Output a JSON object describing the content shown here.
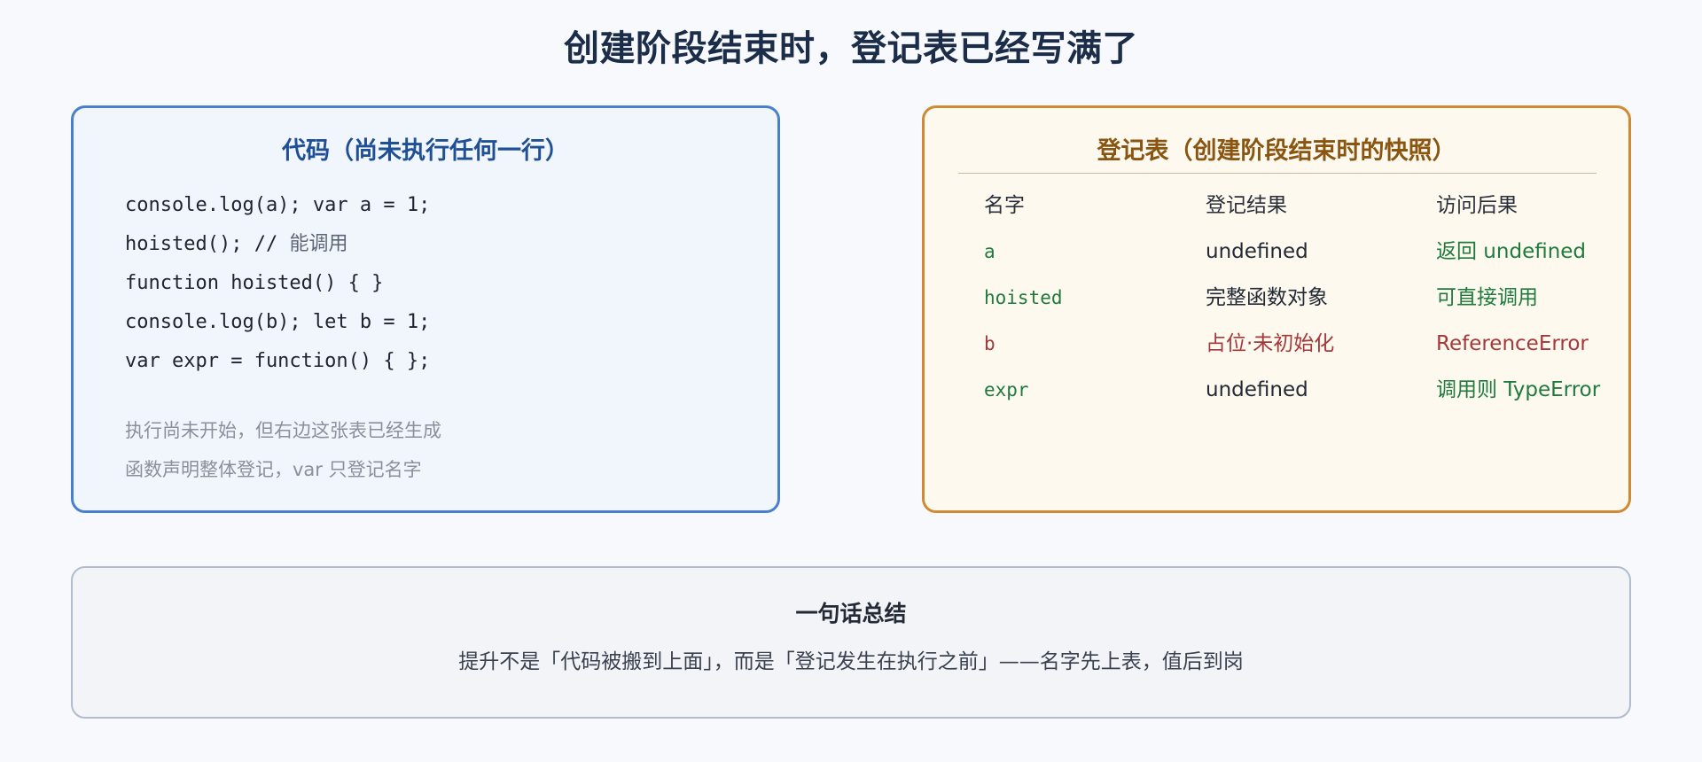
{
  "title": "创建阶段结束时，登记表已经写满了",
  "code_panel": {
    "title": "代码（尚未执行任何一行）",
    "lines": [
      {
        "code": "console.log(a); var a = 1;",
        "comment": ""
      },
      {
        "code": "hoisted(); // ",
        "comment": "能调用"
      },
      {
        "code": "function hoisted() { }",
        "comment": ""
      },
      {
        "code": "console.log(b); let b = 1;",
        "comment": ""
      },
      {
        "code": "var expr = function() { };",
        "comment": ""
      }
    ],
    "notes": [
      "执行尚未开始，但右边这张表已经生成",
      "函数声明整体登记，var 只登记名字"
    ]
  },
  "table_panel": {
    "title": "登记表（创建阶段结束时的快照）",
    "headers": [
      "名字",
      "登记结果",
      "访问后果"
    ],
    "rows": [
      {
        "name": "a",
        "result": "undefined",
        "outcome": "返回 undefined",
        "tone": "ok"
      },
      {
        "name": "hoisted",
        "result": "完整函数对象",
        "outcome": "可直接调用",
        "tone": "ok"
      },
      {
        "name": "b",
        "result": "占位·未初始化",
        "outcome": "ReferenceError",
        "tone": "error"
      },
      {
        "name": "expr",
        "result": "undefined",
        "outcome": "调用则 TypeError",
        "tone": "ok"
      }
    ]
  },
  "summary": {
    "title": "一句话总结",
    "text": "提升不是「代码被搬到上面」，而是「登记发生在执行之前」——名字先上表，值后到岗"
  },
  "colors": {
    "ok_green": "#1f7a3e",
    "error_red": "#a4383a",
    "neutral": "#232a36"
  }
}
